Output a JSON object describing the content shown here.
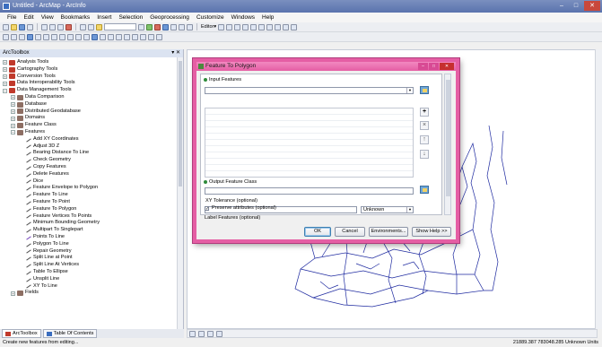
{
  "window": {
    "title": "Untitled - ArcMap - ArcInfo",
    "minimize": "–",
    "maximize": "□",
    "close": "✕"
  },
  "menu": [
    "File",
    "Edit",
    "View",
    "Bookmarks",
    "Insert",
    "Selection",
    "Geoprocessing",
    "Customize",
    "Windows",
    "Help"
  ],
  "toolbar": {
    "scale_value": "",
    "editor_label": "Editor▾"
  },
  "toolbox": {
    "title": "ArcToolbox",
    "header_buttons": "▾ ✕",
    "items": [
      {
        "label": "Analysis Tools",
        "level": 0,
        "kind": "box",
        "exp": "+"
      },
      {
        "label": "Cartography Tools",
        "level": 0,
        "kind": "box",
        "exp": "+"
      },
      {
        "label": "Conversion Tools",
        "level": 0,
        "kind": "box",
        "exp": "+"
      },
      {
        "label": "Data Interoperability Tools",
        "level": 0,
        "kind": "box",
        "exp": "+"
      },
      {
        "label": "Data Management Tools",
        "level": 0,
        "kind": "box",
        "exp": "−"
      },
      {
        "label": "Data Comparison",
        "level": 1,
        "kind": "set",
        "exp": "+"
      },
      {
        "label": "Database",
        "level": 1,
        "kind": "set",
        "exp": "+"
      },
      {
        "label": "Distributed Geodatabase",
        "level": 1,
        "kind": "set",
        "exp": "+"
      },
      {
        "label": "Domains",
        "level": 1,
        "kind": "set",
        "exp": "+"
      },
      {
        "label": "Feature Class",
        "level": 1,
        "kind": "set",
        "exp": "+"
      },
      {
        "label": "Features",
        "level": 1,
        "kind": "set",
        "exp": "−"
      },
      {
        "label": "Add XY Coordinates",
        "level": 2,
        "kind": "tool"
      },
      {
        "label": "Adjust 3D Z",
        "level": 2,
        "kind": "tool"
      },
      {
        "label": "Bearing Distance To Line",
        "level": 2,
        "kind": "tool"
      },
      {
        "label": "Check Geometry",
        "level": 2,
        "kind": "tool"
      },
      {
        "label": "Copy Features",
        "level": 2,
        "kind": "tool"
      },
      {
        "label": "Delete Features",
        "level": 2,
        "kind": "tool"
      },
      {
        "label": "Dice",
        "level": 2,
        "kind": "tool"
      },
      {
        "label": "Feature Envelope to Polygon",
        "level": 2,
        "kind": "tool"
      },
      {
        "label": "Feature To Line",
        "level": 2,
        "kind": "tool"
      },
      {
        "label": "Feature To Point",
        "level": 2,
        "kind": "tool"
      },
      {
        "label": "Feature To Polygon",
        "level": 2,
        "kind": "tool"
      },
      {
        "label": "Feature Vertices To Points",
        "level": 2,
        "kind": "tool"
      },
      {
        "label": "Minimum Bounding Geometry",
        "level": 2,
        "kind": "tool"
      },
      {
        "label": "Multipart To Singlepart",
        "level": 2,
        "kind": "tool"
      },
      {
        "label": "Points To Line",
        "level": 2,
        "kind": "pts"
      },
      {
        "label": "Polygon To Line",
        "level": 2,
        "kind": "tool"
      },
      {
        "label": "Repair Geometry",
        "level": 2,
        "kind": "tool"
      },
      {
        "label": "Split Line at Point",
        "level": 2,
        "kind": "tool"
      },
      {
        "label": "Split Line At Vertices",
        "level": 2,
        "kind": "tool"
      },
      {
        "label": "Table To Ellipse",
        "level": 2,
        "kind": "tool"
      },
      {
        "label": "Unsplit Line",
        "level": 2,
        "kind": "tool"
      },
      {
        "label": "XY To Line",
        "level": 2,
        "kind": "tool"
      },
      {
        "label": "Fields",
        "level": 1,
        "kind": "set",
        "exp": "+"
      }
    ],
    "tabs": [
      "ArcToolbox",
      "Table Of Contents"
    ]
  },
  "dialog": {
    "title": "Feature To Polygon",
    "input_features_label": "Input Features",
    "output_label": "Output Feature Class",
    "xy_tolerance_label": "XY Tolerance (optional)",
    "xy_unit": "Unknown",
    "preserve_label": "Preserve attributes (optional)",
    "label_features_label": "Label Features (optional)",
    "ok": "OK",
    "cancel": "Cancel",
    "environments": "Environments...",
    "show_help": "Show Help >>"
  },
  "status": {
    "left": "Create new features from editing...",
    "coords": "21889.387 783048.285 Unknown Units"
  }
}
